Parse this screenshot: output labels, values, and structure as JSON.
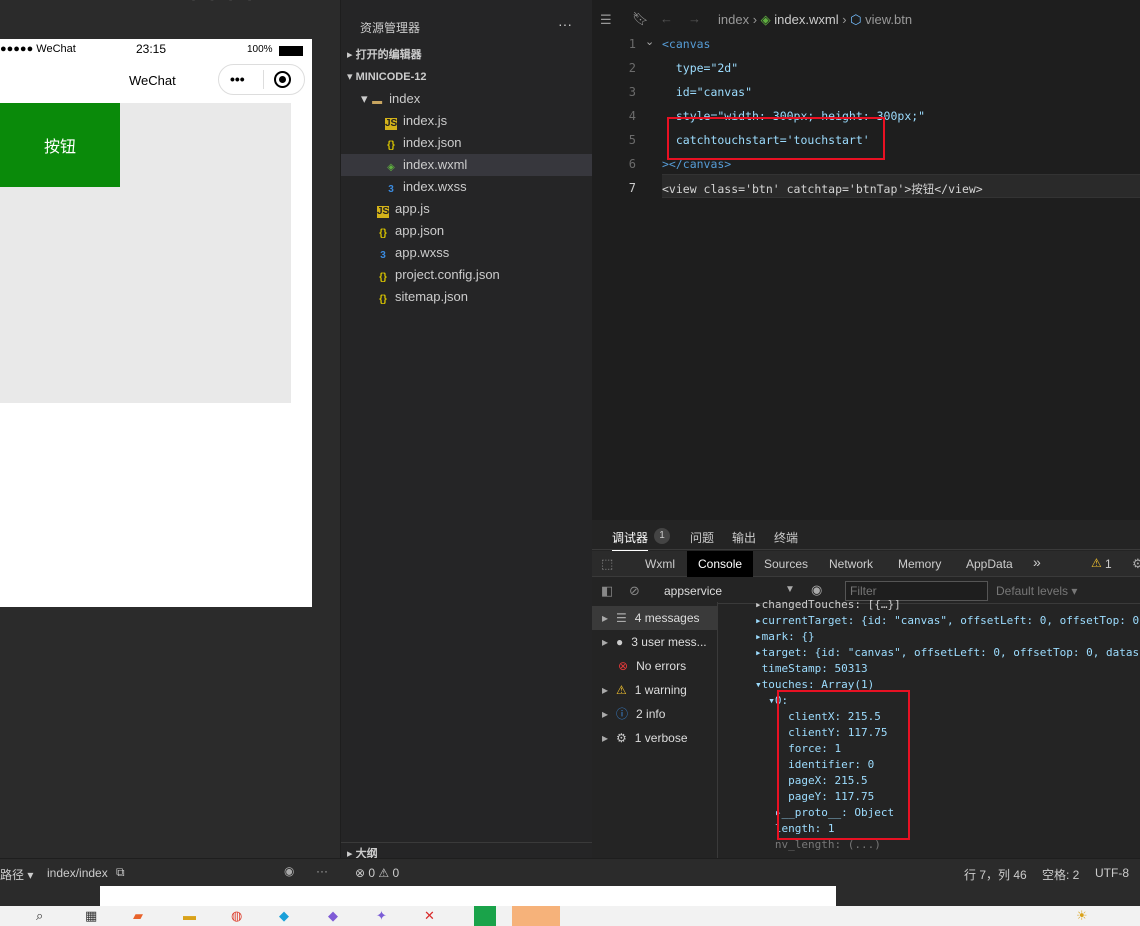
{
  "simulator": {
    "status_carrier": "●●●●● WeChat",
    "status_time": "23:15",
    "status_battery": "100%",
    "nav_title": "WeChat",
    "button_label": "按钮"
  },
  "explorer": {
    "title": "资源管理器",
    "more": "···",
    "open_editors": "打开的编辑器",
    "project": "MINICODE-12",
    "outline": "大纲",
    "items": [
      {
        "label": "index",
        "kind": "folder"
      },
      {
        "label": "index.js",
        "kind": "js"
      },
      {
        "label": "index.json",
        "kind": "json"
      },
      {
        "label": "index.wxml",
        "kind": "wxml"
      },
      {
        "label": "index.wxss",
        "kind": "wxss"
      },
      {
        "label": "app.js",
        "kind": "js"
      },
      {
        "label": "app.json",
        "kind": "json"
      },
      {
        "label": "app.wxss",
        "kind": "wxss"
      },
      {
        "label": "project.config.json",
        "kind": "json"
      },
      {
        "label": "sitemap.json",
        "kind": "json"
      }
    ]
  },
  "editor": {
    "breadcrumb": [
      "index",
      "index.wxml",
      "view.btn"
    ],
    "line_numbers": [
      "1",
      "2",
      "3",
      "4",
      "5",
      "6",
      "7"
    ],
    "lines": [
      "<canvas",
      "  type=\"2d\"",
      "  id=\"canvas\"",
      "  style=\"width: 300px; height: 300px;\"",
      "  catchtouchstart='touchstart'",
      "></canvas>",
      "<view class='btn' catchtap='btnTap'>按钮</view>"
    ]
  },
  "devtools": {
    "panel_tabs": [
      "调试器",
      "问题",
      "输出",
      "终端"
    ],
    "badge": "1",
    "tool_tabs": [
      "Wxml",
      "Console",
      "Sources",
      "Network",
      "Memory",
      "AppData"
    ],
    "more_tabs": "»",
    "warn_count": "1",
    "context": "appservice",
    "filter_placeholder": "Filter",
    "levels": "Default levels ▾",
    "sidebar": [
      {
        "label": "4 messages",
        "icon": "list-icon"
      },
      {
        "label": "3 user mess...",
        "icon": "user-icon"
      },
      {
        "label": "No errors",
        "icon": "error-icon"
      },
      {
        "label": "1 warning",
        "icon": "warning-icon"
      },
      {
        "label": "2 info",
        "icon": "info-icon"
      },
      {
        "label": "1 verbose",
        "icon": "gear-icon"
      }
    ],
    "console_lines": [
      "▸changedTouches: [{…}]",
      "▸currentTarget: {id: \"canvas\", offsetLeft: 0, offsetTop: 0",
      "▸mark: {}",
      "▸target: {id: \"canvas\", offsetLeft: 0, offsetTop: 0, datas",
      " timeStamp: 50313",
      "▾touches: Array(1)",
      "  ▾0:",
      "     clientX: 215.5",
      "     clientY: 117.75",
      "     force: 1",
      "     identifier: 0",
      "     pageX: 215.5",
      "     pageY: 117.75",
      "   ▸__proto__: Object",
      "   length: 1",
      "   nv_length: (...)"
    ]
  },
  "statusbar": {
    "path_label": "路径 ▾",
    "path": "index/index",
    "problems": "⊗ 0 ⚠ 0",
    "position": "行 7，列 46",
    "spaces": "空格: 2",
    "encoding": "UTF-8"
  }
}
